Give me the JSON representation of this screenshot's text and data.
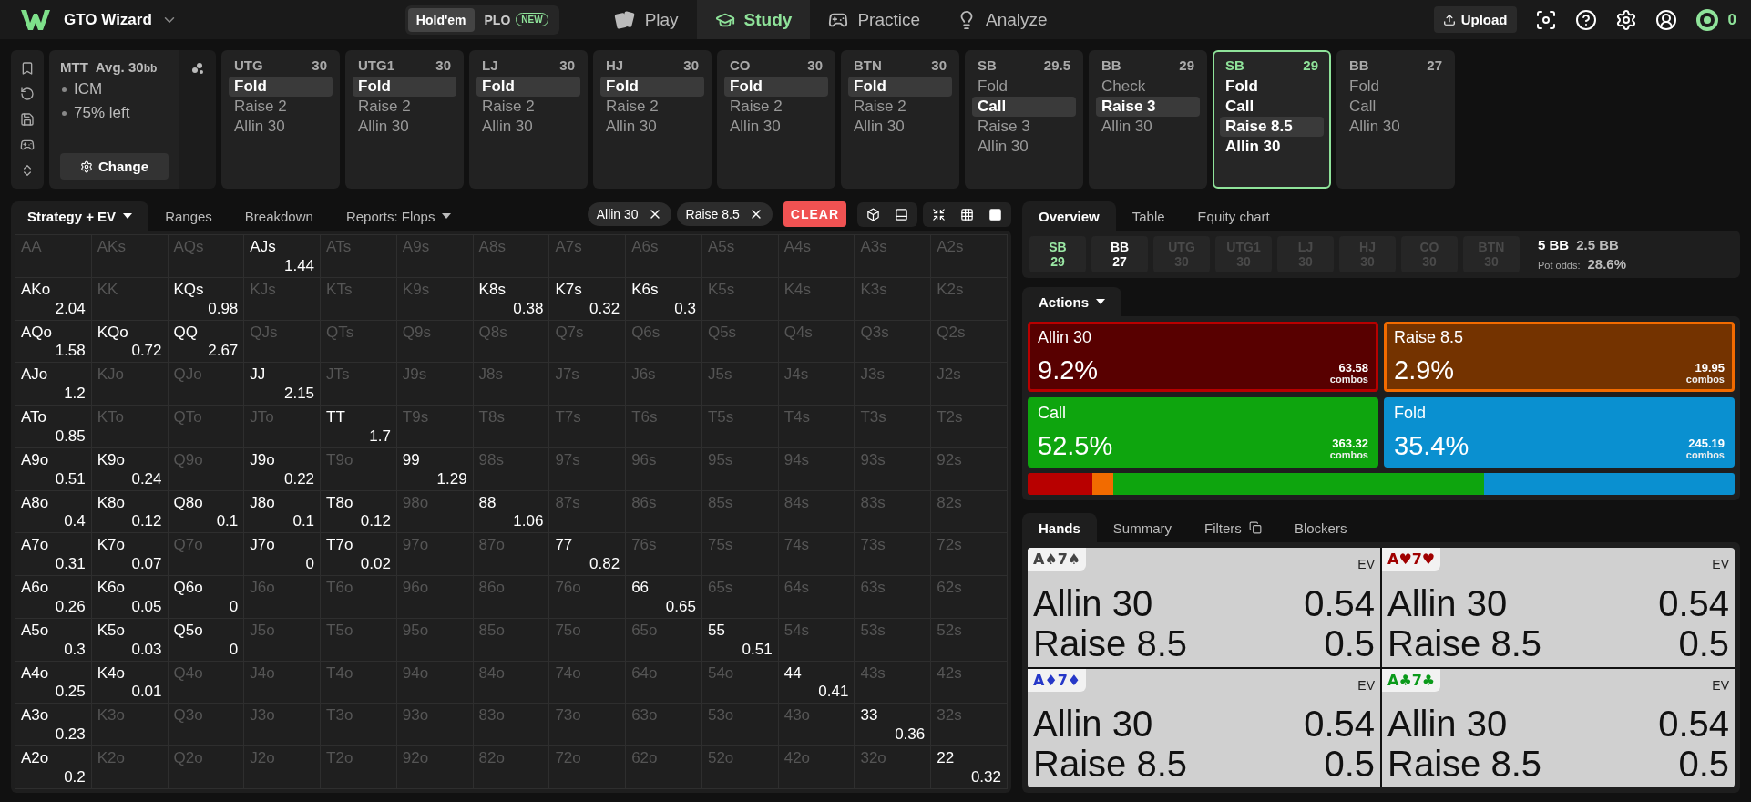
{
  "top_bar": {
    "brand": "GTO Wizard",
    "game_toggle": [
      {
        "label": "Hold'em",
        "selected": true
      },
      {
        "label": "PLO",
        "badge": "NEW",
        "selected": false
      }
    ],
    "nav": [
      {
        "label": "Play",
        "selected": false
      },
      {
        "label": "Study",
        "selected": true
      },
      {
        "label": "Practice",
        "selected": false
      },
      {
        "label": "Analyze",
        "selected": false
      }
    ],
    "upload": "Upload",
    "coins": "0"
  },
  "strip": {
    "info": {
      "format": "MTT",
      "avg": "Avg. 30",
      "avg_unit": "bb",
      "bullets": [
        "ICM",
        "75% left"
      ],
      "change_button": "Change"
    },
    "positions": [
      {
        "name": "UTG",
        "stack": "30",
        "kind": "past",
        "actions": [
          {
            "label": "Fold",
            "selected": true
          },
          {
            "label": "Raise 2",
            "selected": false
          },
          {
            "label": "Allin 30",
            "selected": false
          }
        ]
      },
      {
        "name": "UTG1",
        "stack": "30",
        "kind": "past",
        "actions": [
          {
            "label": "Fold",
            "selected": true
          },
          {
            "label": "Raise 2",
            "selected": false
          },
          {
            "label": "Allin 30",
            "selected": false
          }
        ]
      },
      {
        "name": "LJ",
        "stack": "30",
        "kind": "past",
        "actions": [
          {
            "label": "Fold",
            "selected": true
          },
          {
            "label": "Raise 2",
            "selected": false
          },
          {
            "label": "Allin 30",
            "selected": false
          }
        ]
      },
      {
        "name": "HJ",
        "stack": "30",
        "kind": "past",
        "actions": [
          {
            "label": "Fold",
            "selected": true
          },
          {
            "label": "Raise 2",
            "selected": false
          },
          {
            "label": "Allin 30",
            "selected": false
          }
        ]
      },
      {
        "name": "CO",
        "stack": "30",
        "kind": "past",
        "actions": [
          {
            "label": "Fold",
            "selected": true
          },
          {
            "label": "Raise 2",
            "selected": false
          },
          {
            "label": "Allin 30",
            "selected": false
          }
        ]
      },
      {
        "name": "BTN",
        "stack": "30",
        "kind": "past",
        "actions": [
          {
            "label": "Fold",
            "selected": true
          },
          {
            "label": "Raise 2",
            "selected": false
          },
          {
            "label": "Allin 30",
            "selected": false
          }
        ]
      },
      {
        "name": "SB",
        "stack": "29.5",
        "kind": "past",
        "actions": [
          {
            "label": "Fold",
            "selected": false
          },
          {
            "label": "Call",
            "selected": true
          },
          {
            "label": "Raise 3",
            "selected": false
          },
          {
            "label": "Allin 30",
            "selected": false
          }
        ]
      },
      {
        "name": "BB",
        "stack": "29",
        "kind": "past",
        "actions": [
          {
            "label": "Check",
            "selected": false
          },
          {
            "label": "Raise 3",
            "selected": true
          },
          {
            "label": "Allin 30",
            "selected": false
          }
        ]
      },
      {
        "name": "SB",
        "stack": "29",
        "kind": "current",
        "actions": [
          {
            "label": "Fold",
            "selected": false
          },
          {
            "label": "Call",
            "selected": false
          },
          {
            "label": "Raise 8.5",
            "selected": true
          },
          {
            "label": "Allin 30",
            "selected": false
          }
        ]
      },
      {
        "name": "BB",
        "stack": "27",
        "kind": "future",
        "actions": [
          {
            "label": "Fold",
            "selected": false
          },
          {
            "label": "Call",
            "selected": false
          },
          {
            "label": "Allin 30",
            "selected": false
          }
        ]
      }
    ]
  },
  "strategy": {
    "tabs": [
      {
        "label": "Strategy + EV",
        "selected": true,
        "dropdown": true
      },
      {
        "label": "Ranges",
        "selected": false,
        "dropdown": false
      },
      {
        "label": "Breakdown",
        "selected": false,
        "dropdown": false
      },
      {
        "label": "Reports: Flops",
        "selected": false,
        "dropdown": true
      }
    ],
    "chips": [
      "Allin 30",
      "Raise 8.5"
    ],
    "clear": "CLEAR"
  },
  "matrix": {
    "rows": [
      [
        {
          "hand": "AA",
          "active": false
        },
        {
          "hand": "AKs",
          "active": false
        },
        {
          "hand": "AQs",
          "active": false
        },
        {
          "hand": "AJs",
          "active": true,
          "ev": "1.44"
        },
        {
          "hand": "ATs",
          "active": false
        },
        {
          "hand": "A9s",
          "active": false
        },
        {
          "hand": "A8s",
          "active": false
        },
        {
          "hand": "A7s",
          "active": false
        },
        {
          "hand": "A6s",
          "active": false
        },
        {
          "hand": "A5s",
          "active": false
        },
        {
          "hand": "A4s",
          "active": false
        },
        {
          "hand": "A3s",
          "active": false
        },
        {
          "hand": "A2s",
          "active": false
        }
      ],
      [
        {
          "hand": "AKo",
          "active": true,
          "ev": "2.04"
        },
        {
          "hand": "KK",
          "active": false
        },
        {
          "hand": "KQs",
          "active": true,
          "ev": "0.98"
        },
        {
          "hand": "KJs",
          "active": false
        },
        {
          "hand": "KTs",
          "active": false
        },
        {
          "hand": "K9s",
          "active": false
        },
        {
          "hand": "K8s",
          "active": true,
          "ev": "0.38"
        },
        {
          "hand": "K7s",
          "active": true,
          "ev": "0.32"
        },
        {
          "hand": "K6s",
          "active": true,
          "ev": "0.3"
        },
        {
          "hand": "K5s",
          "active": false
        },
        {
          "hand": "K4s",
          "active": false
        },
        {
          "hand": "K3s",
          "active": false
        },
        {
          "hand": "K2s",
          "active": false
        }
      ],
      [
        {
          "hand": "AQo",
          "active": true,
          "ev": "1.58"
        },
        {
          "hand": "KQo",
          "active": true,
          "ev": "0.72"
        },
        {
          "hand": "QQ",
          "active": true,
          "ev": "2.67"
        },
        {
          "hand": "QJs",
          "active": false
        },
        {
          "hand": "QTs",
          "active": false
        },
        {
          "hand": "Q9s",
          "active": false
        },
        {
          "hand": "Q8s",
          "active": false
        },
        {
          "hand": "Q7s",
          "active": false
        },
        {
          "hand": "Q6s",
          "active": false
        },
        {
          "hand": "Q5s",
          "active": false
        },
        {
          "hand": "Q4s",
          "active": false
        },
        {
          "hand": "Q3s",
          "active": false
        },
        {
          "hand": "Q2s",
          "active": false
        }
      ],
      [
        {
          "hand": "AJo",
          "active": true,
          "ev": "1.2"
        },
        {
          "hand": "KJo",
          "active": false
        },
        {
          "hand": "QJo",
          "active": false
        },
        {
          "hand": "JJ",
          "active": true,
          "ev": "2.15"
        },
        {
          "hand": "JTs",
          "active": false
        },
        {
          "hand": "J9s",
          "active": false
        },
        {
          "hand": "J8s",
          "active": false
        },
        {
          "hand": "J7s",
          "active": false
        },
        {
          "hand": "J6s",
          "active": false
        },
        {
          "hand": "J5s",
          "active": false
        },
        {
          "hand": "J4s",
          "active": false
        },
        {
          "hand": "J3s",
          "active": false
        },
        {
          "hand": "J2s",
          "active": false
        }
      ],
      [
        {
          "hand": "ATo",
          "active": true,
          "ev": "0.85"
        },
        {
          "hand": "KTo",
          "active": false
        },
        {
          "hand": "QTo",
          "active": false
        },
        {
          "hand": "JTo",
          "active": false
        },
        {
          "hand": "TT",
          "active": true,
          "ev": "1.7"
        },
        {
          "hand": "T9s",
          "active": false
        },
        {
          "hand": "T8s",
          "active": false
        },
        {
          "hand": "T7s",
          "active": false
        },
        {
          "hand": "T6s",
          "active": false
        },
        {
          "hand": "T5s",
          "active": false
        },
        {
          "hand": "T4s",
          "active": false
        },
        {
          "hand": "T3s",
          "active": false
        },
        {
          "hand": "T2s",
          "active": false
        }
      ],
      [
        {
          "hand": "A9o",
          "active": true,
          "ev": "0.51"
        },
        {
          "hand": "K9o",
          "active": true,
          "ev": "0.24"
        },
        {
          "hand": "Q9o",
          "active": false
        },
        {
          "hand": "J9o",
          "active": true,
          "ev": "0.22"
        },
        {
          "hand": "T9o",
          "active": false
        },
        {
          "hand": "99",
          "active": true,
          "ev": "1.29"
        },
        {
          "hand": "98s",
          "active": false
        },
        {
          "hand": "97s",
          "active": false
        },
        {
          "hand": "96s",
          "active": false
        },
        {
          "hand": "95s",
          "active": false
        },
        {
          "hand": "94s",
          "active": false
        },
        {
          "hand": "93s",
          "active": false
        },
        {
          "hand": "92s",
          "active": false
        }
      ],
      [
        {
          "hand": "A8o",
          "active": true,
          "ev": "0.4"
        },
        {
          "hand": "K8o",
          "active": true,
          "ev": "0.12"
        },
        {
          "hand": "Q8o",
          "active": true,
          "ev": "0.1"
        },
        {
          "hand": "J8o",
          "active": true,
          "ev": "0.1"
        },
        {
          "hand": "T8o",
          "active": true,
          "ev": "0.12"
        },
        {
          "hand": "98o",
          "active": false
        },
        {
          "hand": "88",
          "active": true,
          "ev": "1.06"
        },
        {
          "hand": "87s",
          "active": false
        },
        {
          "hand": "86s",
          "active": false
        },
        {
          "hand": "85s",
          "active": false
        },
        {
          "hand": "84s",
          "active": false
        },
        {
          "hand": "83s",
          "active": false
        },
        {
          "hand": "82s",
          "active": false
        }
      ],
      [
        {
          "hand": "A7o",
          "active": true,
          "ev": "0.31"
        },
        {
          "hand": "K7o",
          "active": true,
          "ev": "0.07"
        },
        {
          "hand": "Q7o",
          "active": false
        },
        {
          "hand": "J7o",
          "active": true,
          "ev": "0"
        },
        {
          "hand": "T7o",
          "active": true,
          "ev": "0.02"
        },
        {
          "hand": "97o",
          "active": false
        },
        {
          "hand": "87o",
          "active": false
        },
        {
          "hand": "77",
          "active": true,
          "ev": "0.82"
        },
        {
          "hand": "76s",
          "active": false
        },
        {
          "hand": "75s",
          "active": false
        },
        {
          "hand": "74s",
          "active": false
        },
        {
          "hand": "73s",
          "active": false
        },
        {
          "hand": "72s",
          "active": false
        }
      ],
      [
        {
          "hand": "A6o",
          "active": true,
          "ev": "0.26"
        },
        {
          "hand": "K6o",
          "active": true,
          "ev": "0.05"
        },
        {
          "hand": "Q6o",
          "active": true,
          "ev": "0"
        },
        {
          "hand": "J6o",
          "active": false
        },
        {
          "hand": "T6o",
          "active": false
        },
        {
          "hand": "96o",
          "active": false
        },
        {
          "hand": "86o",
          "active": false
        },
        {
          "hand": "76o",
          "active": false
        },
        {
          "hand": "66",
          "active": true,
          "ev": "0.65"
        },
        {
          "hand": "65s",
          "active": false
        },
        {
          "hand": "64s",
          "active": false
        },
        {
          "hand": "63s",
          "active": false
        },
        {
          "hand": "62s",
          "active": false
        }
      ],
      [
        {
          "hand": "A5o",
          "active": true,
          "ev": "0.3"
        },
        {
          "hand": "K5o",
          "active": true,
          "ev": "0.03"
        },
        {
          "hand": "Q5o",
          "active": true,
          "ev": "0"
        },
        {
          "hand": "J5o",
          "active": false
        },
        {
          "hand": "T5o",
          "active": false
        },
        {
          "hand": "95o",
          "active": false
        },
        {
          "hand": "85o",
          "active": false
        },
        {
          "hand": "75o",
          "active": false
        },
        {
          "hand": "65o",
          "active": false
        },
        {
          "hand": "55",
          "active": true,
          "ev": "0.51"
        },
        {
          "hand": "54s",
          "active": false
        },
        {
          "hand": "53s",
          "active": false
        },
        {
          "hand": "52s",
          "active": false
        }
      ],
      [
        {
          "hand": "A4o",
          "active": true,
          "ev": "0.25"
        },
        {
          "hand": "K4o",
          "active": true,
          "ev": "0.01"
        },
        {
          "hand": "Q4o",
          "active": false
        },
        {
          "hand": "J4o",
          "active": false
        },
        {
          "hand": "T4o",
          "active": false
        },
        {
          "hand": "94o",
          "active": false
        },
        {
          "hand": "84o",
          "active": false
        },
        {
          "hand": "74o",
          "active": false
        },
        {
          "hand": "64o",
          "active": false
        },
        {
          "hand": "54o",
          "active": false
        },
        {
          "hand": "44",
          "active": true,
          "ev": "0.41"
        },
        {
          "hand": "43s",
          "active": false
        },
        {
          "hand": "42s",
          "active": false
        }
      ],
      [
        {
          "hand": "A3o",
          "active": true,
          "ev": "0.23"
        },
        {
          "hand": "K3o",
          "active": false
        },
        {
          "hand": "Q3o",
          "active": false
        },
        {
          "hand": "J3o",
          "active": false
        },
        {
          "hand": "T3o",
          "active": false
        },
        {
          "hand": "93o",
          "active": false
        },
        {
          "hand": "83o",
          "active": false
        },
        {
          "hand": "73o",
          "active": false
        },
        {
          "hand": "63o",
          "active": false
        },
        {
          "hand": "53o",
          "active": false
        },
        {
          "hand": "43o",
          "active": false
        },
        {
          "hand": "33",
          "active": true,
          "ev": "0.36"
        },
        {
          "hand": "32s",
          "active": false
        }
      ],
      [
        {
          "hand": "A2o",
          "active": true,
          "ev": "0.2"
        },
        {
          "hand": "K2o",
          "active": false
        },
        {
          "hand": "Q2o",
          "active": false
        },
        {
          "hand": "J2o",
          "active": false
        },
        {
          "hand": "T2o",
          "active": false
        },
        {
          "hand": "92o",
          "active": false
        },
        {
          "hand": "82o",
          "active": false
        },
        {
          "hand": "72o",
          "active": false
        },
        {
          "hand": "62o",
          "active": false
        },
        {
          "hand": "52o",
          "active": false
        },
        {
          "hand": "42o",
          "active": false
        },
        {
          "hand": "32o",
          "active": false
        },
        {
          "hand": "22",
          "active": true,
          "ev": "0.32"
        }
      ]
    ]
  },
  "overview": {
    "tabs": [
      {
        "label": "Overview",
        "selected": true
      },
      {
        "label": "Table",
        "selected": false
      },
      {
        "label": "Equity chart",
        "selected": false
      }
    ],
    "seats": [
      {
        "name": "SB",
        "stack": "29",
        "current": true,
        "folded": false
      },
      {
        "name": "BB",
        "stack": "27",
        "current": false,
        "folded": false
      },
      {
        "name": "UTG",
        "stack": "30",
        "current": false,
        "folded": true
      },
      {
        "name": "UTG1",
        "stack": "30",
        "current": false,
        "folded": true
      },
      {
        "name": "LJ",
        "stack": "30",
        "current": false,
        "folded": true
      },
      {
        "name": "HJ",
        "stack": "30",
        "current": false,
        "folded": true
      },
      {
        "name": "CO",
        "stack": "30",
        "current": false,
        "folded": true
      },
      {
        "name": "BTN",
        "stack": "30",
        "current": false,
        "folded": true
      }
    ],
    "pot": {
      "total": "5 BB",
      "call": "2.5 BB",
      "odds_label": "Pot odds:",
      "odds": "28.6%"
    }
  },
  "actions": {
    "dropdown": "Actions",
    "cards": [
      {
        "name": "Allin 30",
        "percent": "9.2%",
        "combos": "63.58",
        "unit": "combos",
        "color": "#b80000",
        "selected": true
      },
      {
        "name": "Raise 8.5",
        "percent": "2.9%",
        "combos": "19.95",
        "unit": "combos",
        "color": "#f26b00",
        "selected": true
      },
      {
        "name": "Call",
        "percent": "52.5%",
        "combos": "363.32",
        "unit": "combos",
        "color": "#0ea50e",
        "selected": false
      },
      {
        "name": "Fold",
        "percent": "35.4%",
        "combos": "245.19",
        "unit": "combos",
        "color": "#0a90d0",
        "selected": false
      }
    ]
  },
  "hands": {
    "tabs": [
      {
        "label": "Hands",
        "selected": true,
        "icon": false
      },
      {
        "label": "Summary",
        "selected": false,
        "icon": false
      },
      {
        "label": "Filters",
        "selected": false,
        "icon": true
      },
      {
        "label": "Blockers",
        "selected": false,
        "icon": false
      }
    ],
    "cards": [
      {
        "combo": "A♠7♠",
        "color": "#444444",
        "ev_label": "EV",
        "rows": [
          {
            "action": "Allin 30",
            "ev": "0.54"
          },
          {
            "action": "Raise 8.5",
            "ev": "0.5"
          }
        ]
      },
      {
        "combo": "A♥7♥",
        "color": "#a00000",
        "ev_label": "EV",
        "rows": [
          {
            "action": "Allin 30",
            "ev": "0.54"
          },
          {
            "action": "Raise 8.5",
            "ev": "0.5"
          }
        ]
      },
      {
        "combo": "A♦7♦",
        "color": "#2638c8",
        "ev_label": "EV",
        "rows": [
          {
            "action": "Allin 30",
            "ev": "0.54"
          },
          {
            "action": "Raise 8.5",
            "ev": "0.5"
          }
        ]
      },
      {
        "combo": "A♣7♣",
        "color": "#0a9a1a",
        "ev_label": "EV",
        "rows": [
          {
            "action": "Allin 30",
            "ev": "0.54"
          },
          {
            "action": "Raise 8.5",
            "ev": "0.5"
          }
        ]
      }
    ]
  }
}
